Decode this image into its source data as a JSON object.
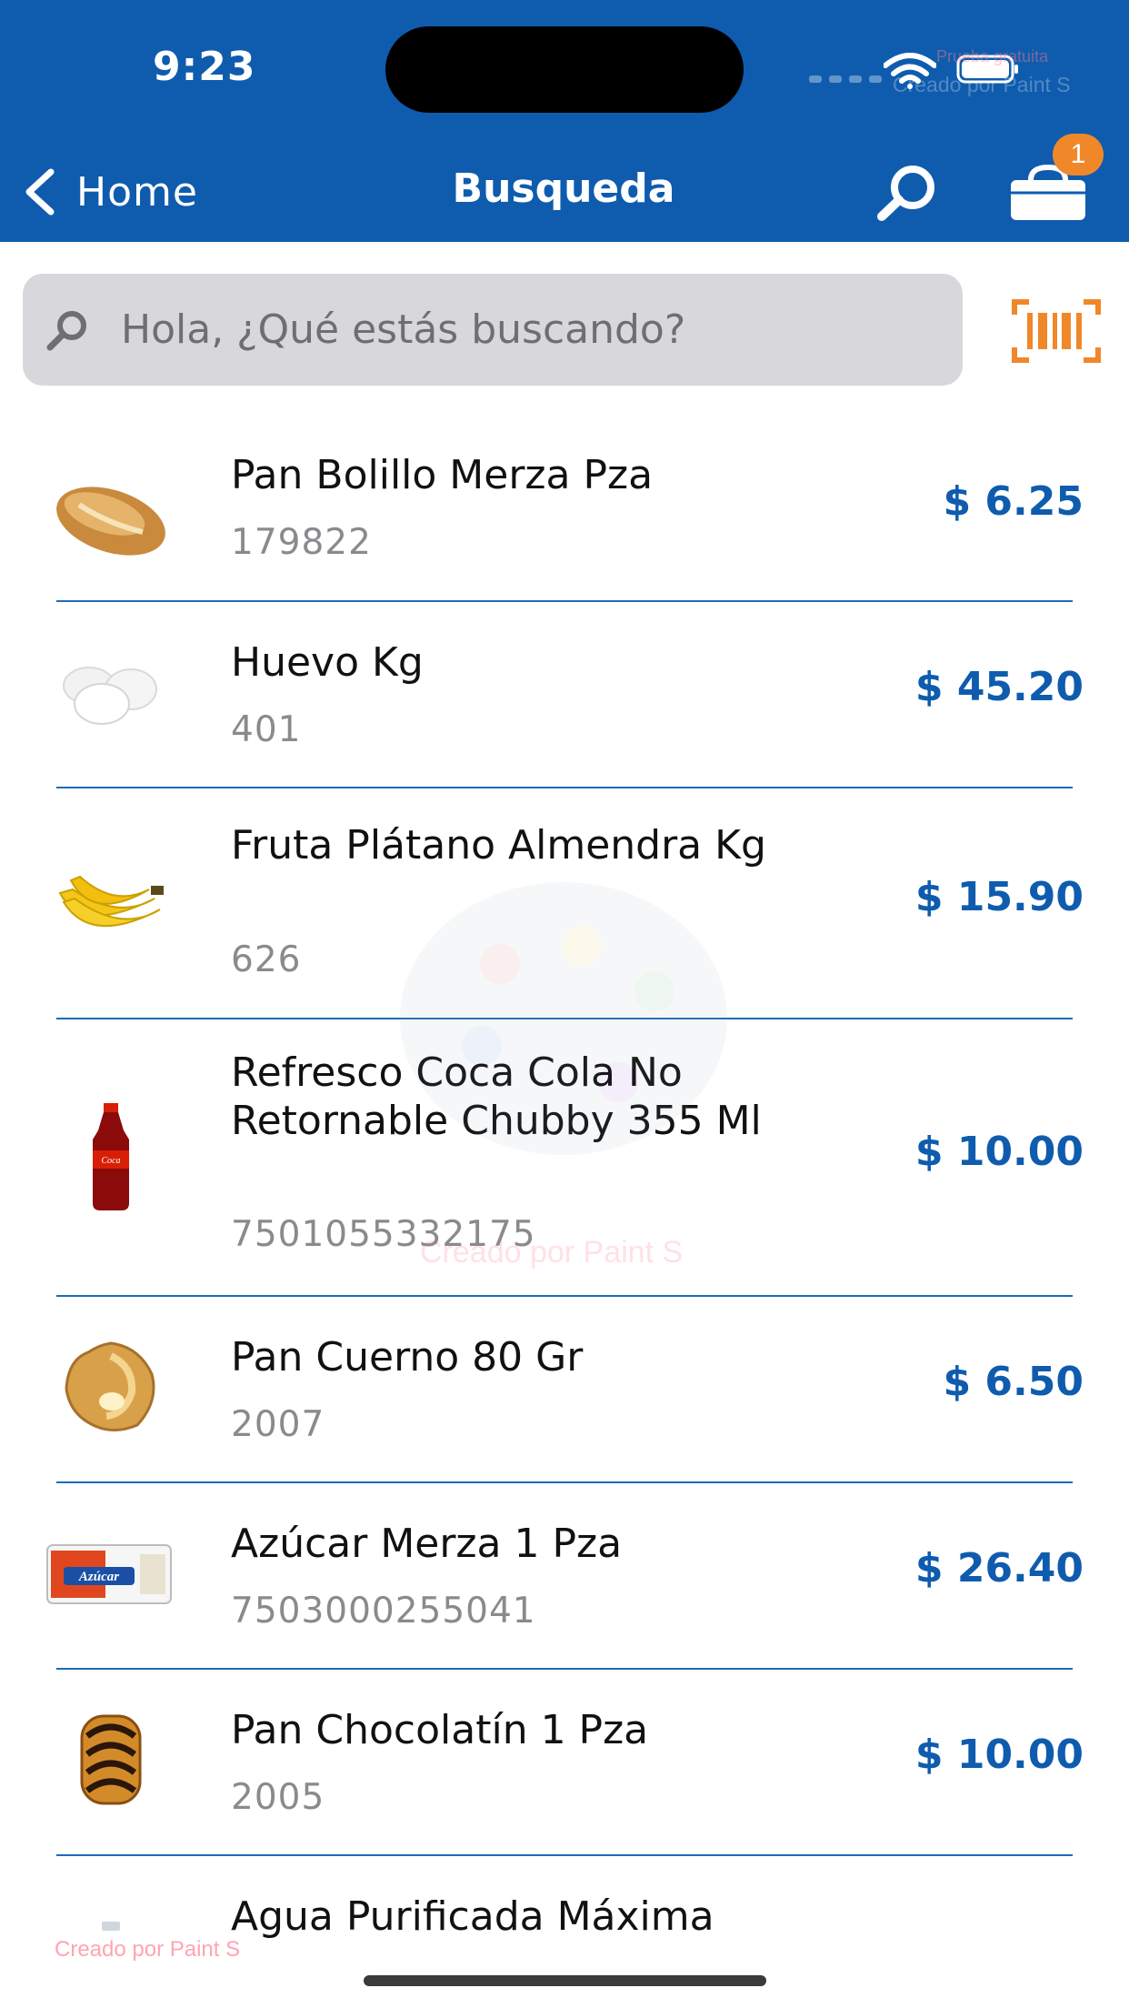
{
  "status_bar": {
    "time": "9:23",
    "watermark": "Creado por Paint S",
    "watermark_small": "Prueba gratuita"
  },
  "nav": {
    "back_label": "Home",
    "title": "Busqueda",
    "cart_badge": "1"
  },
  "search": {
    "placeholder": "Hola, ¿Qué estás buscando?"
  },
  "products": [
    {
      "name": "Pan Bolillo Merza Pza",
      "code": "179822",
      "price": "$ 6.25",
      "icon": "bread-roll-icon"
    },
    {
      "name": "Huevo Kg",
      "code": "401",
      "price": "$ 45.20",
      "icon": "eggs-icon"
    },
    {
      "name": "Fruta Plátano Almendra Kg",
      "code": "626",
      "price": "$ 15.90",
      "icon": "banana-icon"
    },
    {
      "name": "Refresco Coca Cola No Retornable Chubby 355 Ml",
      "code": "7501055332175",
      "price": "$ 10.00",
      "icon": "soda-bottle-icon"
    },
    {
      "name": "Pan Cuerno 80 Gr",
      "code": "2007",
      "price": "$ 6.50",
      "icon": "croissant-icon"
    },
    {
      "name": "Azúcar Merza 1 Pza",
      "code": "7503000255041",
      "price": "$ 26.40",
      "icon": "sugar-bag-icon",
      "package_label": "Azúcar"
    },
    {
      "name": "Pan Chocolatín 1 Pza",
      "code": "2005",
      "price": "$ 10.00",
      "icon": "chocolate-bread-icon"
    },
    {
      "name": "Agua Purificada Máxima",
      "code": "",
      "price": "",
      "icon": "water-bottle-icon"
    }
  ],
  "watermarks": {
    "center": "Creado por Paint S",
    "bottom": "Creado por Paint S"
  },
  "colors": {
    "header": "#0F5CAE",
    "price": "#0F5CAE",
    "badge": "#F0882A",
    "barcode": "#F0882A",
    "search_bg": "#D8D8DC"
  }
}
